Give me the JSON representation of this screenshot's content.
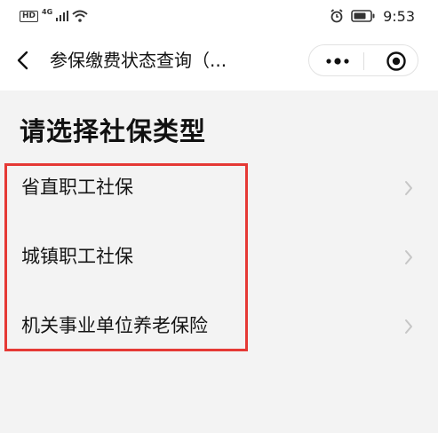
{
  "status_bar": {
    "network_badge": "HD",
    "network_type": "4G",
    "signal_icon": "signal-icon",
    "wifi_icon": "wifi-icon",
    "alarm_icon": "alarm-icon",
    "battery_icon": "battery-icon",
    "time": "9:53"
  },
  "nav": {
    "back_icon": "chevron-left-icon",
    "title": "参保缴费状态查询（...",
    "more_icon": "more-dots-icon",
    "close_icon": "target-icon"
  },
  "heading": "请选择社保类型",
  "options": [
    {
      "label": "省直职工社保",
      "icon": "chevron-right-icon"
    },
    {
      "label": "城镇职工社保",
      "icon": "chevron-right-icon"
    },
    {
      "label": "机关事业单位养老保险",
      "icon": "chevron-right-icon"
    }
  ],
  "colors": {
    "background": "#f3f3f3",
    "bar": "#ffffff",
    "highlight": "#e53935",
    "chevron": "#c6c6c6"
  }
}
